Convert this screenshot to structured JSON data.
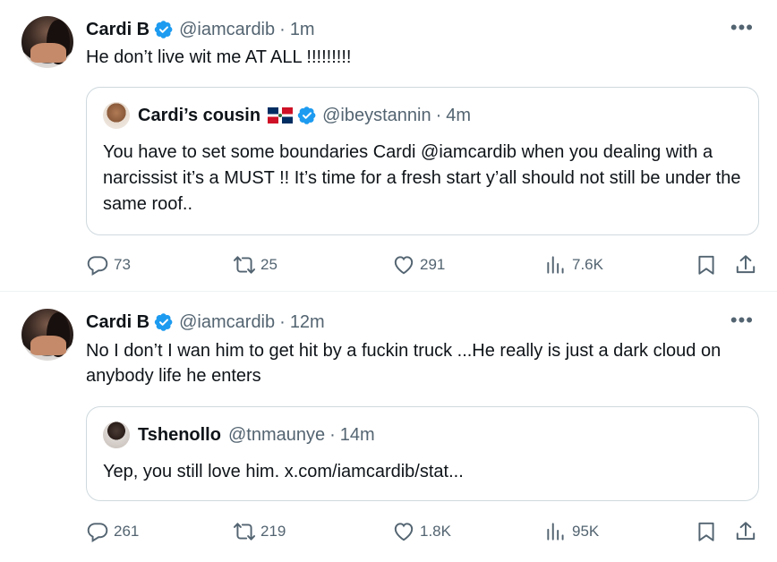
{
  "tweets": [
    {
      "author": {
        "name": "Cardi B",
        "handle": "@iamcardib",
        "time": "1m"
      },
      "text": "He don’t live wit me AT ALL !!!!!!!!!",
      "quote": {
        "author": {
          "name": "Cardi’s cousin",
          "handle": "@ibeystannin",
          "time": "4m"
        },
        "text": "You have to set some boundaries Cardi @iamcardib when you dealing with a narcissist it’s a MUST !!  It’s time for a fresh start y’all should not still be under the same roof.."
      },
      "stats": {
        "replies": "73",
        "reposts": "25",
        "likes": "291",
        "views": "7.6K"
      }
    },
    {
      "author": {
        "name": "Cardi B",
        "handle": "@iamcardib",
        "time": "12m"
      },
      "text": "No I don’t I wan him to get hit by a fuckin truck ...He really is just a dark cloud on anybody life he enters",
      "quote": {
        "author": {
          "name": "Tshenollo",
          "handle": "@tnmaunye",
          "time": "14m"
        },
        "text": "Yep, you still love him. x.com/iamcardib/stat..."
      },
      "stats": {
        "replies": "261",
        "reposts": "219",
        "likes": "1.8K",
        "views": "95K"
      }
    }
  ],
  "ui": {
    "dot": "·",
    "more": "•••"
  },
  "colors": {
    "verified": "#1d9bf0",
    "secondary": "#536471",
    "border": "#cfd9de"
  }
}
